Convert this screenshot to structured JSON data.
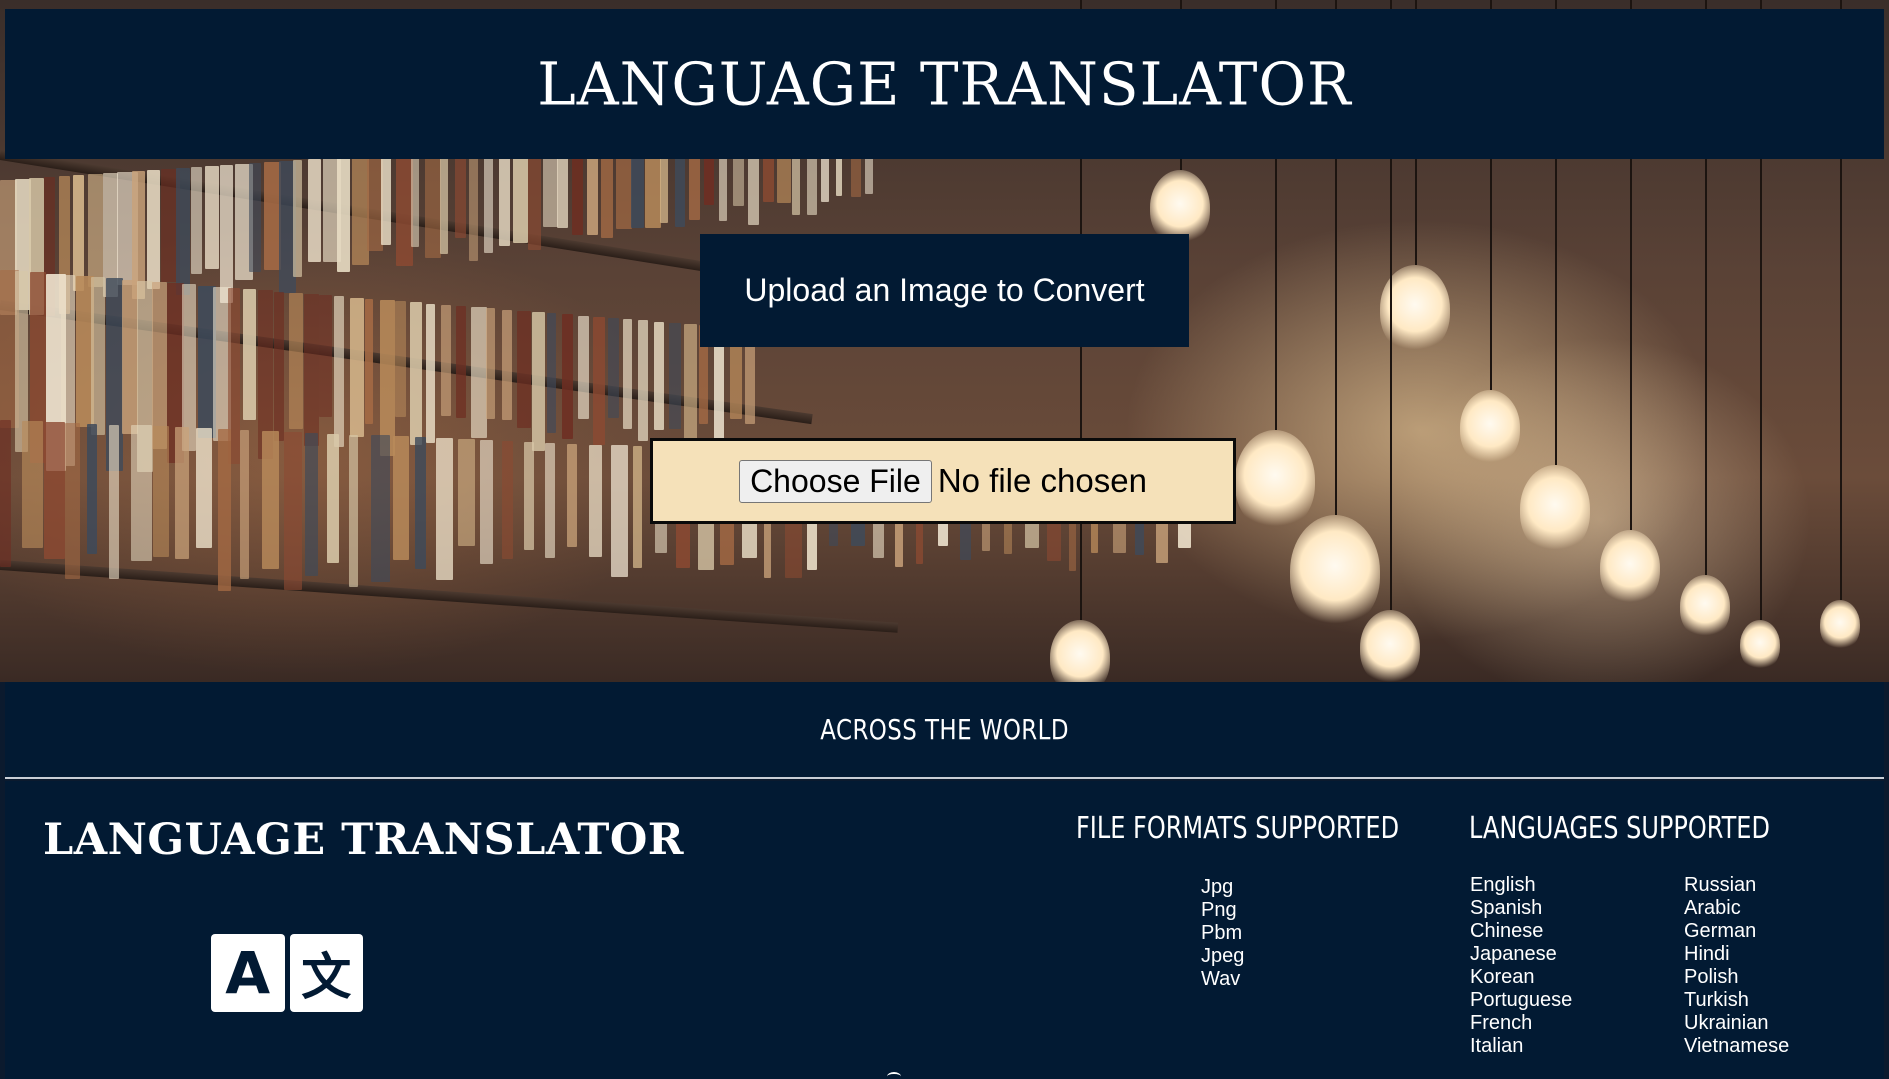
{
  "header": {
    "title": "LANGUAGE TRANSLATOR"
  },
  "upload": {
    "label": "Upload an Image to Convert",
    "choose_button": "Choose File",
    "status": "No file chosen"
  },
  "banner": {
    "text": "ACROSS THE WORLD"
  },
  "footer": {
    "title": "LANGUAGE TRANSLATOR",
    "logo": {
      "icon": "translate-icon",
      "left_glyph": "A",
      "right_glyph": "文"
    },
    "formats": {
      "heading": "FILE FORMATS SUPPORTED",
      "items": [
        "Jpg",
        "Png",
        "Pbm",
        "Jpeg",
        "Wav"
      ]
    },
    "languages": {
      "heading": "LANGUAGES SUPPORTED",
      "col1": [
        "English",
        "Spanish",
        "Chinese",
        "Japanese",
        "Korean",
        "Portuguese",
        "French",
        "Italian"
      ],
      "col2": [
        "Russian",
        "Arabic",
        "German",
        "Hindi",
        "Polish",
        "Turkish",
        "Ukrainian",
        "Vietnamese"
      ]
    }
  },
  "colors": {
    "navy": "#021a33",
    "file_box_bg": "#f5e1b9",
    "text": "#ffffff"
  }
}
